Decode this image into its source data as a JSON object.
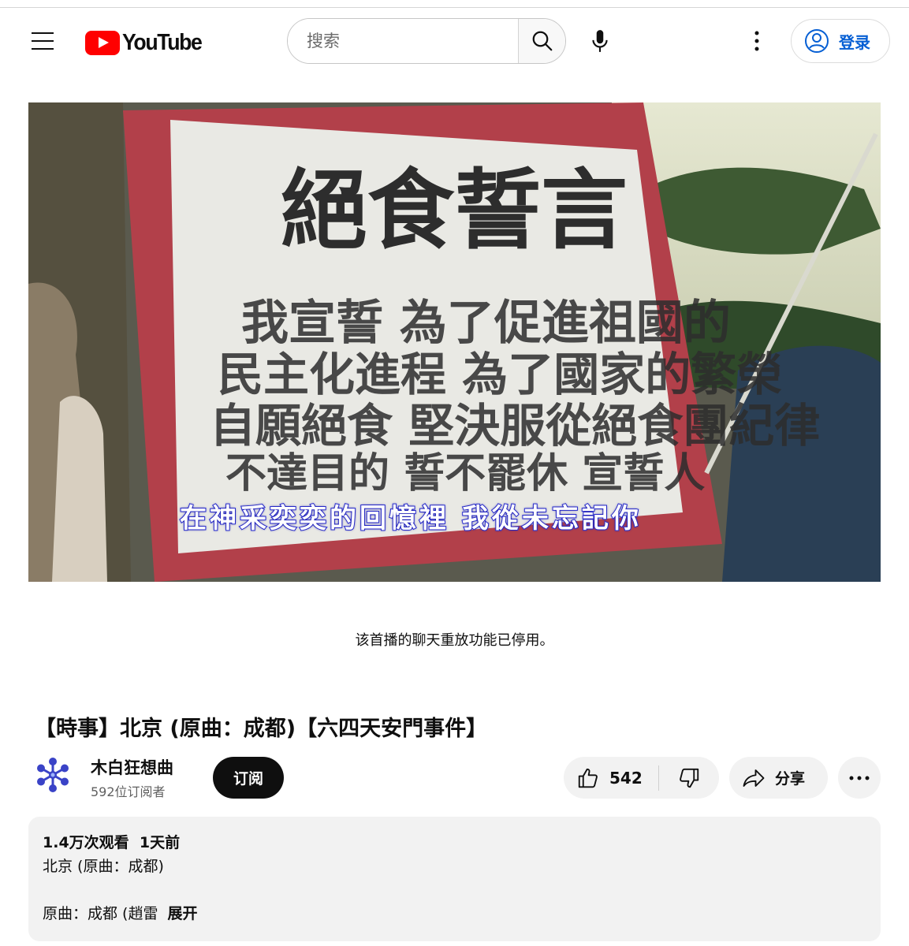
{
  "header": {
    "logo_text": "YouTube",
    "search_placeholder": "搜索",
    "signin_label": "登录"
  },
  "video": {
    "subtitle": "在神采奕奕的回憶裡 我從未忘記你"
  },
  "chat": {
    "disabled_notice": "该首播的聊天重放功能已停用。"
  },
  "meta": {
    "title": "【時事】北京 (原曲：成都)【六四天安門事件】",
    "channel_name": "木白狂想曲",
    "subscribers": "592位订阅者",
    "subscribe_label": "订阅",
    "like_count": "542",
    "share_label": "分享"
  },
  "description": {
    "views": "1.4万次观看",
    "age": "1天前",
    "line1": "北京 (原曲：成都)",
    "line2": "原曲：成都 (趙雷",
    "expand_label": "展开"
  },
  "colors": {
    "brand_red": "#ff0000",
    "link_blue": "#065fd4",
    "subtitle_blue": "#2b2fd8"
  }
}
